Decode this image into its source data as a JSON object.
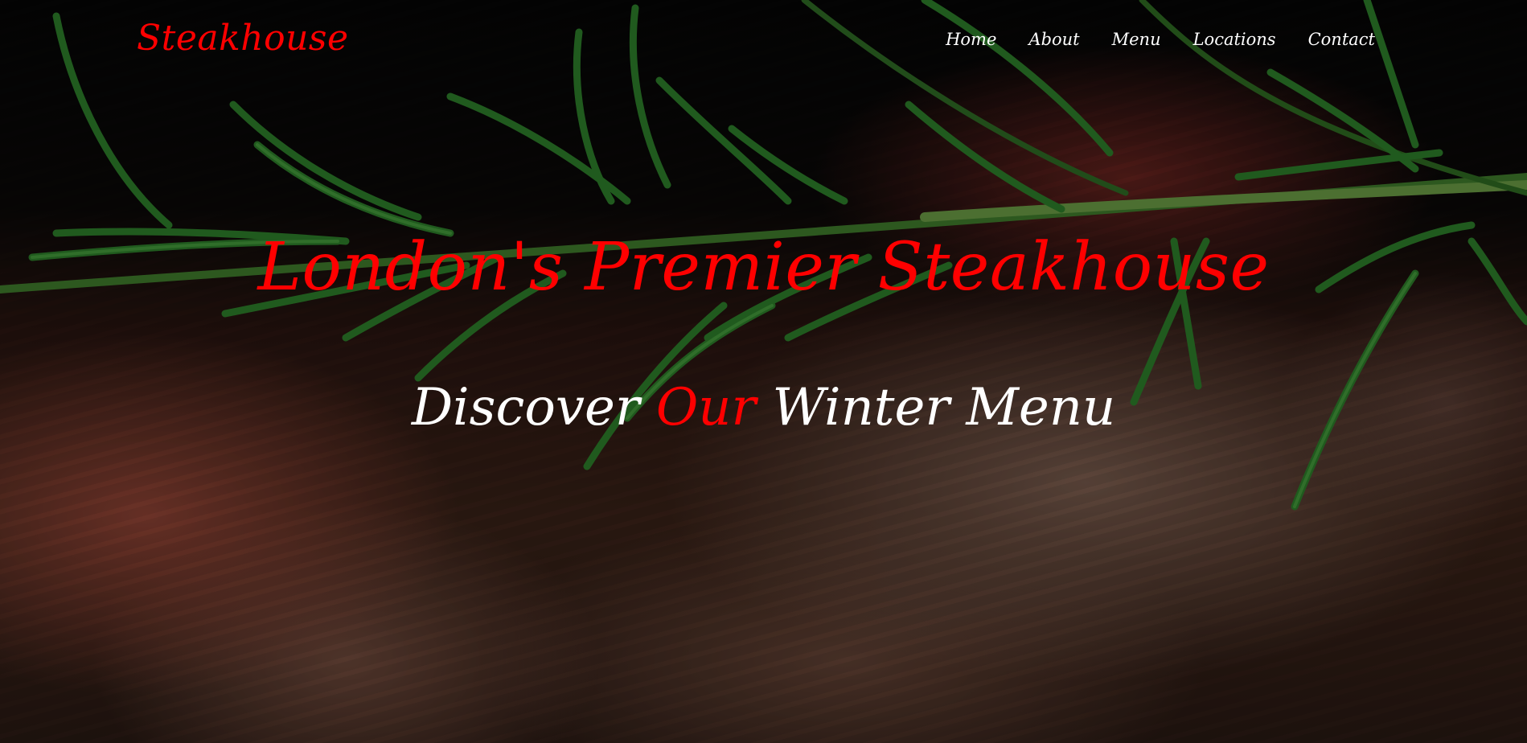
{
  "brand": {
    "name": "Steakhouse",
    "color": "#ff0000"
  },
  "nav": {
    "items": [
      {
        "label": "Home"
      },
      {
        "label": "About"
      },
      {
        "label": "Menu"
      },
      {
        "label": "Locations"
      },
      {
        "label": "Contact"
      }
    ]
  },
  "hero": {
    "background_image": "grilled-steak-with-rosemary",
    "title": "London's Premier Steakhouse",
    "subtitle": {
      "before": "Discover ",
      "highlight": "Our",
      "after": " Winter Menu"
    },
    "accent_color": "#ff0000",
    "text_color": "#ffffff"
  }
}
